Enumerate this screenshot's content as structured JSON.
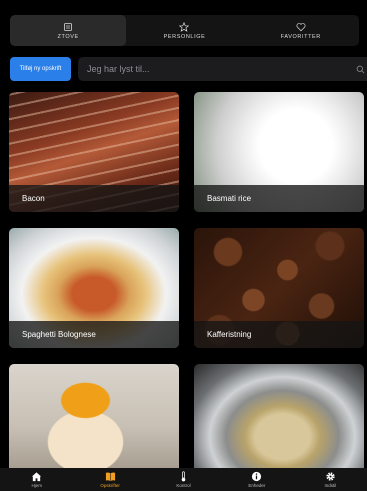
{
  "tabs": [
    {
      "label": "ZTOVE",
      "icon": "list-icon",
      "active": true
    },
    {
      "label": "PERSONLIGE",
      "icon": "star-icon",
      "active": false
    },
    {
      "label": "FAVORITTER",
      "icon": "heart-icon",
      "active": false
    }
  ],
  "actions": {
    "add_label": "Tilføj ny opskrift",
    "search_placeholder": "Jeg har lyst til..."
  },
  "recipes": [
    {
      "title": "Bacon"
    },
    {
      "title": "Basmati rice"
    },
    {
      "title": "Spaghetti Bolognese"
    },
    {
      "title": "Kafferistning"
    },
    {
      "title": "",
      "image": "egg-yolk"
    },
    {
      "title": "",
      "image": "soup-pot"
    }
  ],
  "bottom_nav": [
    {
      "label": "Hjem",
      "icon": "home-icon",
      "active": false
    },
    {
      "label": "Opskrifter",
      "icon": "book-icon",
      "active": true
    },
    {
      "label": "Kontrol",
      "icon": "thermometer-icon",
      "active": false
    },
    {
      "label": "Enheder",
      "icon": "info-icon",
      "active": false
    },
    {
      "label": "Indstil",
      "icon": "gear-icon",
      "active": false
    }
  ],
  "colors": {
    "accent": "#2a7fe8",
    "active_nav": "#f0a020",
    "background": "#000000"
  }
}
